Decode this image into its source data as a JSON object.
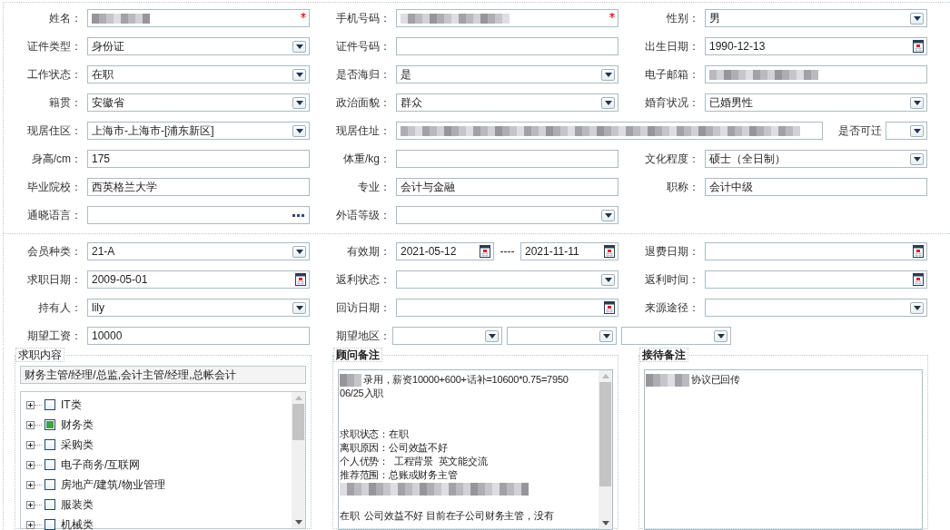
{
  "personal": {
    "rows": [
      [
        {
          "label": "姓名：",
          "kind": "text",
          "redacted": true,
          "required": true
        },
        {
          "label": "手机号码：",
          "kind": "text",
          "redacted": true,
          "required": true
        },
        {
          "label": "性别：",
          "kind": "select",
          "value": "男"
        }
      ],
      [
        {
          "label": "证件类型：",
          "kind": "select",
          "value": "身份证"
        },
        {
          "label": "证件号码：",
          "kind": "text"
        },
        {
          "label": "出生日期：",
          "kind": "date",
          "value": "1990-12-13"
        }
      ],
      [
        {
          "label": "工作状态：",
          "kind": "select",
          "value": "在职"
        },
        {
          "label": "是否海归：",
          "kind": "select",
          "value": "是"
        },
        {
          "label": "电子邮箱：",
          "kind": "text",
          "redacted": true
        }
      ],
      [
        {
          "label": "籍贯：",
          "kind": "select",
          "value": "安徽省"
        },
        {
          "label": "政治面貌：",
          "kind": "select",
          "value": "群众"
        },
        {
          "label": "婚育状况：",
          "kind": "select",
          "value": "已婚男性"
        }
      ],
      [
        {
          "label": "现居住区：",
          "kind": "select",
          "value": " 上海市-上海市-[浦东新区]"
        },
        {
          "label": "现居住址：",
          "kind": "text",
          "redacted": true,
          "extra": {
            "label": "是否可迁",
            "kind": "select"
          }
        }
      ],
      [
        {
          "label": "身高/cm：",
          "kind": "text",
          "value": "175"
        },
        {
          "label": "体重/kg：",
          "kind": "text"
        },
        {
          "label": "文化程度：",
          "kind": "select",
          "value": "硕士（全日制）"
        }
      ],
      [
        {
          "label": "毕业院校：",
          "kind": "text",
          "value": "西英格兰大学"
        },
        {
          "label": "专业：",
          "kind": "text",
          "value": "会计与金融"
        },
        {
          "label": "职称：",
          "kind": "text",
          "value": "会计中级"
        }
      ],
      [
        {
          "label": "通晓语言：",
          "kind": "lookup"
        },
        {
          "label": "外语等级：",
          "kind": "select"
        }
      ]
    ]
  },
  "membership": {
    "rows": [
      [
        {
          "label": "会员种类：",
          "kind": "select",
          "value": " 21-A"
        },
        {
          "label": "有效期：",
          "kind": "date_range",
          "value": "2021-05-12",
          "separator": "----",
          "value_to": "2021-11-11"
        },
        {
          "label": "退费日期：",
          "kind": "date"
        }
      ],
      [
        {
          "label": "求职日期：",
          "kind": "date",
          "value": "2009-05-01"
        },
        {
          "label": "返利状态：",
          "kind": "select"
        },
        {
          "label": "返利时间：",
          "kind": "date"
        }
      ],
      [
        {
          "label": "持有人：",
          "kind": "select",
          "value": "lily"
        },
        {
          "label": "回访日期：",
          "kind": "date"
        },
        {
          "label": "来源途径：",
          "kind": "select"
        }
      ],
      [
        {
          "label": "期望工资：",
          "kind": "text",
          "value": "10000"
        },
        {
          "label": "期望地区：",
          "kind": "multi_select",
          "parts": [
            {
              "kind": "select"
            },
            {
              "kind": "select"
            },
            {
              "kind": "select"
            }
          ]
        }
      ]
    ]
  },
  "job_content": {
    "legend": "求职内容",
    "summary": "财务主管/经理/总监,会计主管/经理,总帐会计",
    "tree": [
      {
        "label": "IT类",
        "checked": false
      },
      {
        "label": "财务类",
        "checked": true
      },
      {
        "label": "采购类",
        "checked": false
      },
      {
        "label": "电子商务/互联网",
        "checked": false
      },
      {
        "label": "房地产/建筑/物业管理",
        "checked": false
      },
      {
        "label": "服装类",
        "checked": false
      },
      {
        "label": "机械类",
        "checked": false
      }
    ]
  },
  "advisor_notes": {
    "legend": "顾问备注",
    "lines": [
      {
        "kind": "text",
        "redacted": true,
        "text": "录用，薪资10000+600+话补=10600*0.75=7950"
      },
      {
        "kind": "text",
        "text": "06/25入职"
      },
      {
        "kind": "blank"
      },
      {
        "kind": "blank"
      },
      {
        "kind": "text",
        "text": "求职状态：在职"
      },
      {
        "kind": "text",
        "text": "离职原因：公司效益不好"
      },
      {
        "kind": "text",
        "text": "个人优势：  工程背景  英文能交流"
      },
      {
        "kind": "text",
        "text": "推荐范围：总账或财务主管"
      },
      {
        "kind": "text",
        "redacted": true
      },
      {
        "kind": "blank"
      },
      {
        "kind": "text",
        "text": "在职  公司效益不好 目前在子公司财务主管，没有"
      }
    ]
  },
  "reception_notes": {
    "legend": "接待备注",
    "lines": [
      {
        "kind": "text",
        "redacted": true,
        "text": "协议已回传"
      }
    ]
  }
}
